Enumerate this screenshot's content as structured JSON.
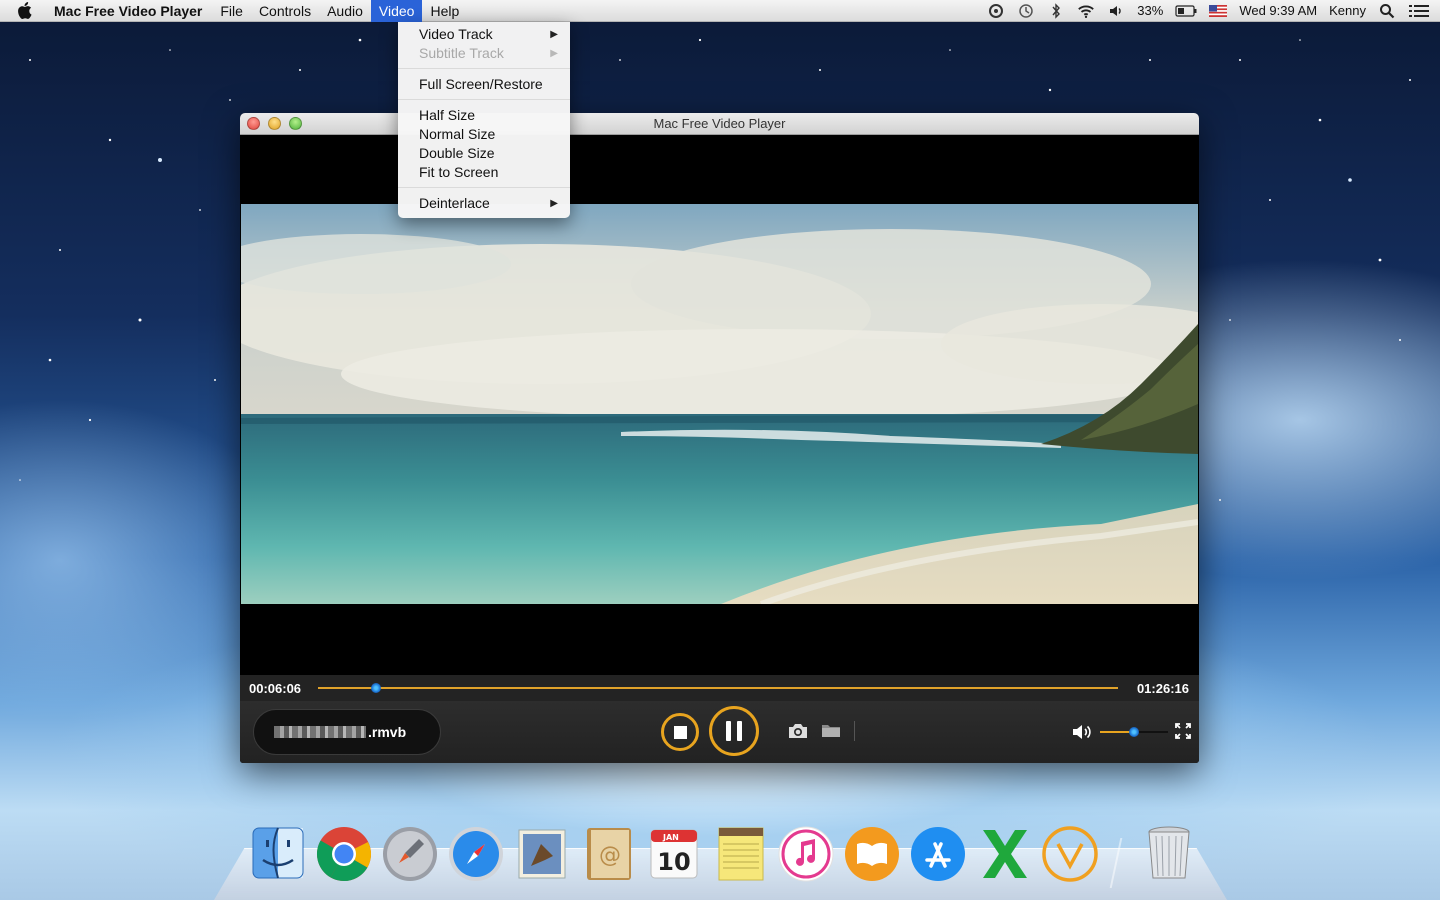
{
  "menubar": {
    "app_name": "Mac Free Video Player",
    "items": [
      {
        "label": "File",
        "active": false
      },
      {
        "label": "Controls",
        "active": false
      },
      {
        "label": "Audio",
        "active": false
      },
      {
        "label": "Video",
        "active": true
      },
      {
        "label": "Help",
        "active": false
      }
    ],
    "status": {
      "battery": "33%",
      "datetime": "Wed 9:39 AM",
      "user": "Kenny",
      "icons": [
        "spotlight-like-icon",
        "time-machine-icon",
        "bluetooth-icon",
        "wifi-icon",
        "volume-icon",
        "battery-icon",
        "us-flag-icon",
        "search-icon",
        "list-icon"
      ]
    },
    "accent": "#2a63d8"
  },
  "video_menu": {
    "items": [
      {
        "label": "Video Track",
        "submenu": true,
        "enabled": true
      },
      {
        "label": "Subtitle Track",
        "submenu": true,
        "enabled": false
      },
      {
        "label": "Full Screen/Restore",
        "submenu": false,
        "enabled": true
      },
      {
        "label": "Half Size",
        "submenu": false,
        "enabled": true
      },
      {
        "label": "Normal Size",
        "submenu": false,
        "enabled": true
      },
      {
        "label": "Double Size",
        "submenu": false,
        "enabled": true
      },
      {
        "label": "Fit to Screen",
        "submenu": false,
        "enabled": true
      },
      {
        "label": "Deinterlace",
        "submenu": true,
        "enabled": true
      }
    ]
  },
  "window": {
    "title": "Mac Free Video Player",
    "current_time": "00:06:06",
    "total_time": "01:26:16",
    "progress_fraction": 0.072,
    "file_name": ".rmvb",
    "volume_fraction": 0.5,
    "accent": "#e8a41f"
  },
  "dock": {
    "apps": [
      "finder-icon",
      "chrome-icon",
      "launchpad-icon",
      "safari-icon",
      "mail-icon",
      "contacts-icon",
      "calendar-icon",
      "notes-icon",
      "itunes-icon",
      "ibooks-icon",
      "app-store-icon",
      "excel-icon",
      "video-player-icon",
      "trash-icon"
    ],
    "calendar_month": "JAN",
    "calendar_day": "10"
  }
}
